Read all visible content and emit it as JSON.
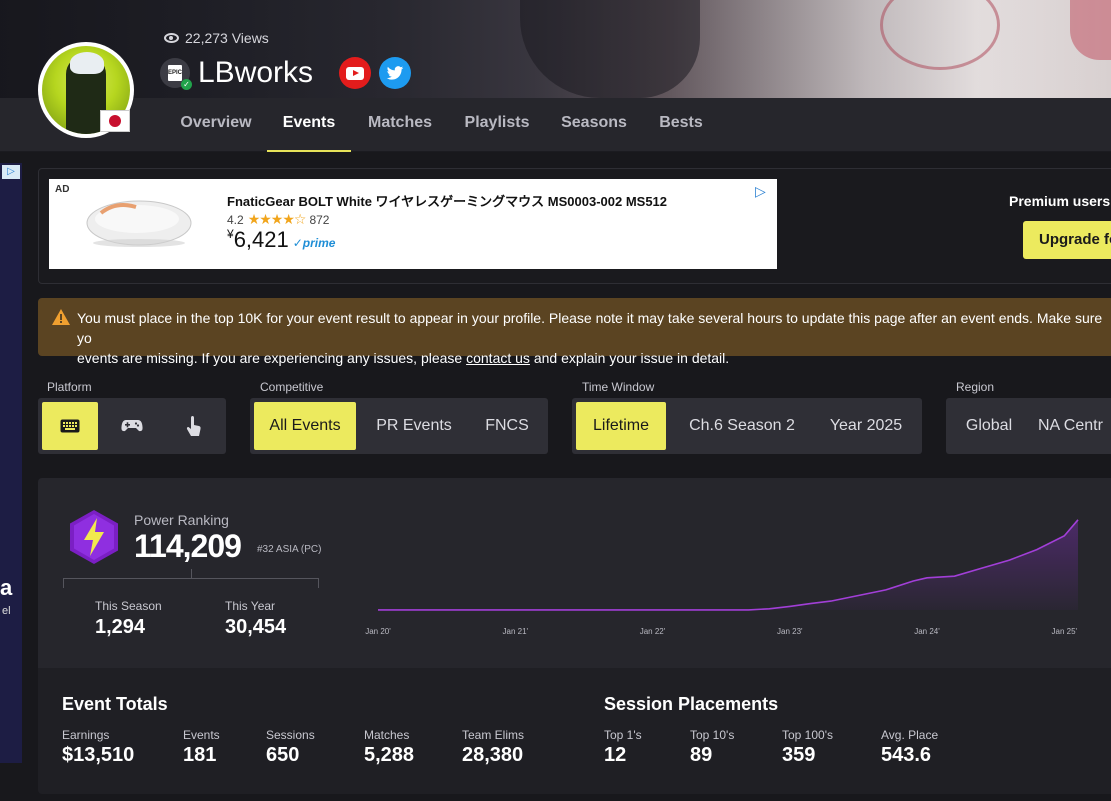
{
  "profile": {
    "views": "22,273 Views",
    "name": "LBworks",
    "platform_badge": "EPIC",
    "country": "Japan"
  },
  "colors": {
    "accent": "#ecea5e",
    "chart_line": "#a23fd8",
    "notice_bg": "#5b4422",
    "power_hex": "#7b1fc4"
  },
  "nav": {
    "tabs": [
      {
        "label": "Overview"
      },
      {
        "label": "Events"
      },
      {
        "label": "Matches"
      },
      {
        "label": "Playlists"
      },
      {
        "label": "Seasons"
      },
      {
        "label": "Bests"
      }
    ],
    "active": "Events"
  },
  "ad": {
    "label": "AD",
    "title": "FnaticGear BOLT White ワイヤレスゲーミングマウス MS0003-002 MS512",
    "rating": "4.2",
    "stars": "★★★★☆",
    "reviews": "872",
    "currency": "¥",
    "price": "6,421",
    "prime": "✓prime"
  },
  "premium": {
    "text": "Premium users",
    "button": "Upgrade fo"
  },
  "notice": {
    "text_before": "You must place in the top 10K for your event result to appear in your profile. Please note it may take several hours to update this page after an event ends. Make sure yo",
    "text_line2": "events are missing. If you are experiencing any issues, please ",
    "link": "contact us",
    "text_after": " and explain your issue in detail."
  },
  "filters": {
    "platform": {
      "label": "Platform",
      "options": [
        "keyboard-icon",
        "gamepad-icon",
        "touch-icon"
      ],
      "selected": "keyboard-icon"
    },
    "competitive": {
      "label": "Competitive",
      "options": [
        "All Events",
        "PR Events",
        "FNCS"
      ],
      "selected": "All Events"
    },
    "time_window": {
      "label": "Time Window",
      "options": [
        "Lifetime",
        "Ch.6 Season 2",
        "Year 2025"
      ],
      "selected": "Lifetime"
    },
    "region": {
      "label": "Region",
      "options": [
        "Global",
        "NA Centr"
      ],
      "selected": ""
    }
  },
  "power_ranking": {
    "label": "Power Ranking",
    "value": "114,209",
    "rank": "#32 ASIA (PC)",
    "this_season_label": "This Season",
    "this_season_value": "1,294",
    "this_year_label": "This Year",
    "this_year_value": "30,454"
  },
  "chart_data": {
    "type": "area",
    "x_ticks": [
      "Jan 20'",
      "Jan 21'",
      "Jan 22'",
      "Jan 23'",
      "Jan 24'",
      "Jan 25'"
    ],
    "x": [
      2020.0,
      2020.5,
      2021.0,
      2021.5,
      2022.0,
      2022.3,
      2022.5,
      2022.7,
      2022.85,
      2023.0,
      2023.15,
      2023.3,
      2023.5,
      2023.7,
      2023.9,
      2024.0,
      2024.2,
      2024.4,
      2024.6,
      2024.8,
      2025.0,
      2025.1
    ],
    "y": [
      114,
      114,
      115,
      115,
      114,
      114,
      113,
      114,
      1500,
      4500,
      8000,
      11000,
      18000,
      25000,
      36000,
      40000,
      42000,
      52000,
      62000,
      75000,
      92000,
      112000
    ],
    "ylim": [
      0,
      114209
    ]
  },
  "event_totals": {
    "title": "Event Totals",
    "items": [
      {
        "label": "Earnings",
        "value": "$13,510"
      },
      {
        "label": "Events",
        "value": "181"
      },
      {
        "label": "Sessions",
        "value": "650"
      },
      {
        "label": "Matches",
        "value": "5,288"
      },
      {
        "label": "Team Elims",
        "value": "28,380"
      }
    ]
  },
  "session_placements": {
    "title": "Session Placements",
    "items": [
      {
        "label": "Top 1's",
        "value": "12"
      },
      {
        "label": "Top 10's",
        "value": "89"
      },
      {
        "label": "Top 100's",
        "value": "359"
      },
      {
        "label": "Avg. Place",
        "value": "543.6"
      }
    ]
  },
  "side_ad": {
    "text1": "a",
    "text2": "el"
  }
}
